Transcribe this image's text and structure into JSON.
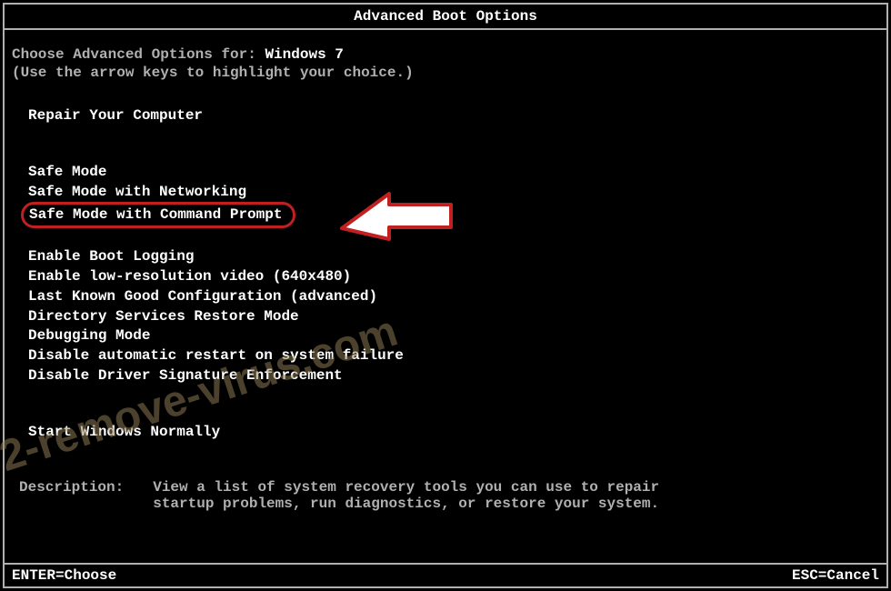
{
  "header": {
    "title": "Advanced Boot Options"
  },
  "choose": {
    "prefix": "Choose Advanced Options for: ",
    "os": "Windows 7",
    "hint": "(Use the arrow keys to highlight your choice.)"
  },
  "menu": {
    "repair": "Repair Your Computer",
    "safe": "Safe Mode",
    "safe_net": "Safe Mode with Networking",
    "safe_cmd": "Safe Mode with Command Prompt",
    "boot_log": "Enable Boot Logging",
    "lowres": "Enable low-resolution video (640x480)",
    "lkgc": "Last Known Good Configuration (advanced)",
    "dsrm": "Directory Services Restore Mode",
    "debug": "Debugging Mode",
    "no_restart": "Disable automatic restart on system failure",
    "no_sig": "Disable Driver Signature Enforcement",
    "normal": "Start Windows Normally"
  },
  "description": {
    "label": "Description:",
    "text": "View a list of system recovery tools you can use to repair startup problems, run diagnostics, or restore your system."
  },
  "footer": {
    "enter": "ENTER=Choose",
    "esc": "ESC=Cancel"
  },
  "watermark": "2-remove-virus.com"
}
